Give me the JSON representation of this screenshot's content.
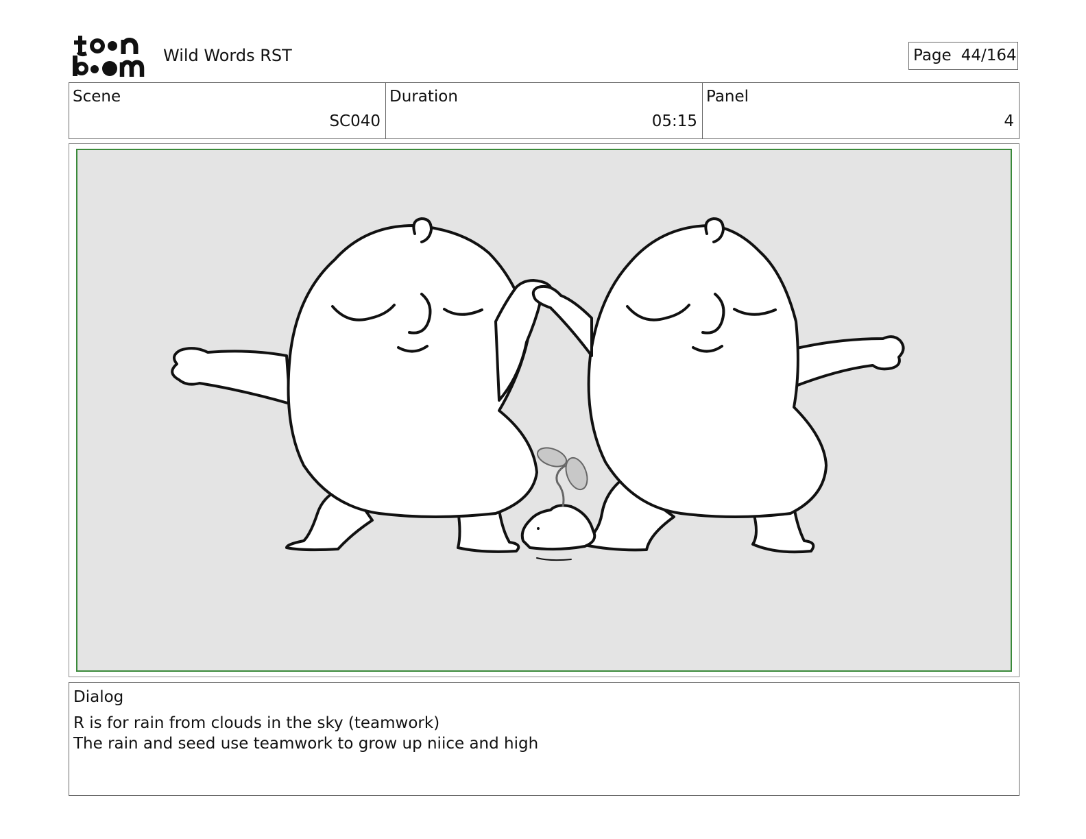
{
  "header": {
    "logo_text": "toon boom",
    "project_title": "Wild Words RST",
    "page_label": "Page",
    "page_number": "44/164"
  },
  "info": {
    "scene": {
      "label": "Scene",
      "value": "SC040"
    },
    "duration": {
      "label": "Duration",
      "value": "05:15"
    },
    "panel": {
      "label": "Panel",
      "value": "4"
    }
  },
  "panel_image": {
    "description_icon": "storyboard-drawing-icon",
    "frame_color": "#3a8a3a",
    "background_color": "#e4e4e4"
  },
  "dialog": {
    "label": "Dialog",
    "lines": [
      "R is for rain from clouds in the sky (teamwork)",
      "The rain and seed use teamwork to grow up niice and high"
    ]
  }
}
